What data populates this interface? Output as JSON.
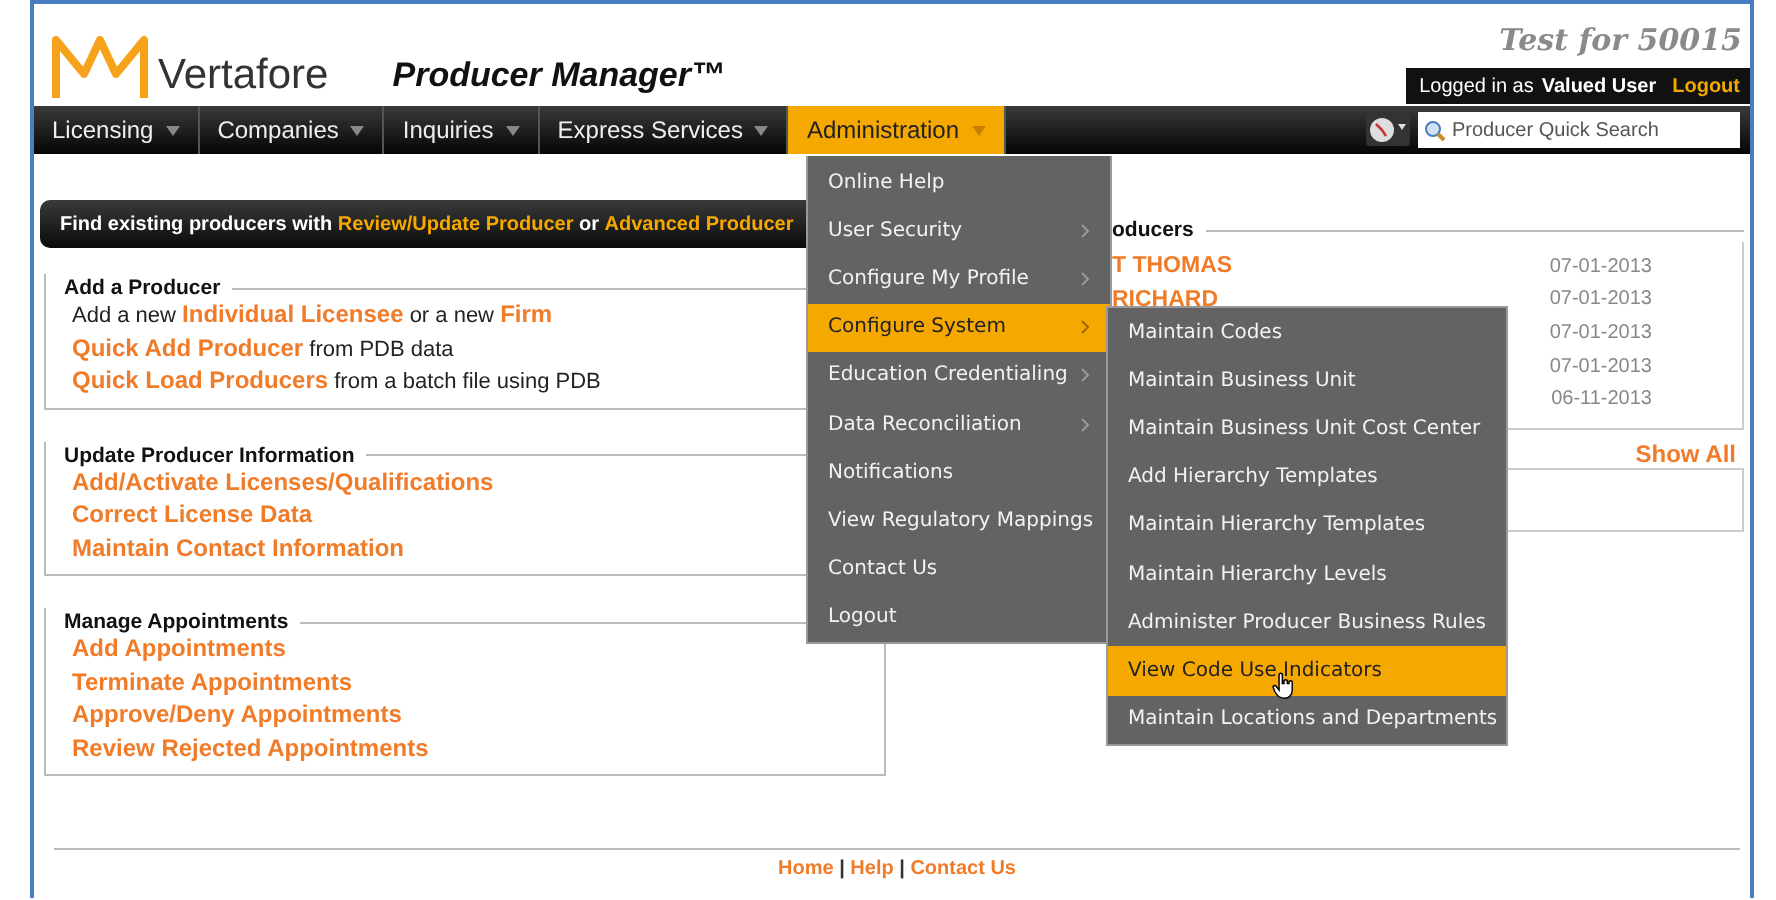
{
  "header": {
    "logo_text": "Vertafore",
    "product_title": "Producer Manager™",
    "environment": "Test for 50015",
    "session": {
      "prefix": "Logged in as",
      "user": "Valued User",
      "logout": "Logout"
    }
  },
  "nav": {
    "items": [
      {
        "label": "Licensing",
        "selected": false
      },
      {
        "label": "Companies",
        "selected": false
      },
      {
        "label": "Inquiries",
        "selected": false
      },
      {
        "label": "Express Services",
        "selected": false
      },
      {
        "label": "Administration",
        "selected": true
      }
    ],
    "search": {
      "placeholder": "Producer Quick Search"
    }
  },
  "banner": {
    "segments": [
      {
        "text": "Find existing producers with",
        "kind": "plain"
      },
      {
        "text": "Review/Update Producer",
        "kind": "link"
      },
      {
        "text": "or",
        "kind": "plain"
      },
      {
        "text": "Advanced Producer",
        "kind": "link"
      }
    ]
  },
  "sections": [
    {
      "title": "Add a Producer",
      "lines": [
        {
          "segments": [
            {
              "text": "Add a new",
              "kind": "plain"
            },
            {
              "text": "Individual Licensee",
              "kind": "link"
            },
            {
              "text": "or a new",
              "kind": "plain"
            },
            {
              "text": "Firm",
              "kind": "link"
            }
          ]
        },
        {
          "segments": [
            {
              "text": "Quick Add Producer",
              "kind": "link"
            },
            {
              "text": "from PDB data",
              "kind": "plain"
            }
          ]
        },
        {
          "segments": [
            {
              "text": "Quick Load Producers",
              "kind": "link"
            },
            {
              "text": "from a batch file using PDB",
              "kind": "plain"
            }
          ]
        }
      ]
    },
    {
      "title": "Update Producer Information",
      "lines": [
        {
          "segments": [
            {
              "text": "Add/Activate Licenses/Qualifications",
              "kind": "link"
            }
          ]
        },
        {
          "segments": [
            {
              "text": "Correct License Data",
              "kind": "link"
            }
          ]
        },
        {
          "segments": [
            {
              "text": "Maintain Contact Information",
              "kind": "link"
            }
          ]
        }
      ]
    },
    {
      "title": "Manage Appointments",
      "lines": [
        {
          "segments": [
            {
              "text": "Add Appointments",
              "kind": "link"
            }
          ]
        },
        {
          "segments": [
            {
              "text": "Terminate Appointments",
              "kind": "link"
            }
          ]
        },
        {
          "segments": [
            {
              "text": "Approve/Deny Appointments",
              "kind": "link"
            }
          ]
        },
        {
          "segments": [
            {
              "text": "Review Rejected Appointments",
              "kind": "link"
            }
          ]
        }
      ]
    }
  ],
  "recent": {
    "title": "oducers",
    "rows": [
      {
        "name": "T THOMAS",
        "date": "07-01-2013"
      },
      {
        "name": "RICHARD",
        "date": "07-01-2013"
      },
      {
        "date": "07-01-2013"
      },
      {
        "date": "07-01-2013"
      },
      {
        "date": "06-11-2013"
      }
    ],
    "show_all": "Show All"
  },
  "admin_menu": {
    "items": [
      {
        "label": "Online Help",
        "has_submenu": false,
        "selected": false
      },
      {
        "label": "User Security",
        "has_submenu": true,
        "selected": false
      },
      {
        "label": "Configure My Profile",
        "has_submenu": true,
        "selected": false
      },
      {
        "label": "Configure System",
        "has_submenu": true,
        "selected": true
      },
      {
        "label": "Education Credentialing",
        "has_submenu": true,
        "selected": false
      },
      {
        "label": "Data Reconciliation",
        "has_submenu": true,
        "selected": false
      },
      {
        "label": "Notifications",
        "has_submenu": false,
        "selected": false
      },
      {
        "label": "View Regulatory Mappings",
        "has_submenu": false,
        "selected": false
      },
      {
        "label": "Contact Us",
        "has_submenu": false,
        "selected": false
      },
      {
        "label": "Logout",
        "has_submenu": false,
        "selected": false
      }
    ],
    "submenu": [
      {
        "label": "Maintain Codes",
        "selected": false
      },
      {
        "label": "Maintain Business Unit",
        "selected": false
      },
      {
        "label": "Maintain Business Unit Cost Center",
        "selected": false
      },
      {
        "label": "Add Hierarchy Templates",
        "selected": false
      },
      {
        "label": "Maintain Hierarchy Templates",
        "selected": false
      },
      {
        "label": "Maintain Hierarchy Levels",
        "selected": false
      },
      {
        "label": "Administer Producer Business Rules",
        "selected": false
      },
      {
        "label": "View Code Use Indicators",
        "selected": true
      },
      {
        "label": "Maintain Locations and Departments",
        "selected": false
      }
    ]
  },
  "footer": {
    "links": [
      "Home",
      "Help",
      "Contact Us"
    ],
    "separator": "|"
  }
}
